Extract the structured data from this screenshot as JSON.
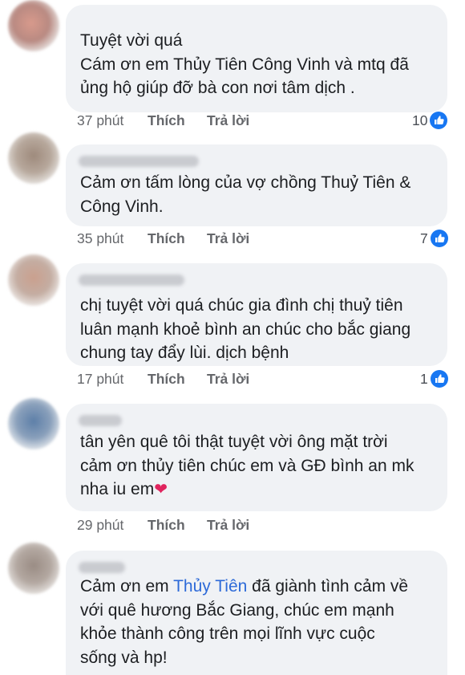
{
  "comments": [
    {
      "lines": [
        "Tuyệt vời quá",
        "Cám ơn em Thủy Tiên Công Vinh và mtq đã",
        "ủng hộ giúp đỡ bà con nơi tâm dịch ."
      ],
      "time": "37 phút",
      "like_label": "Thích",
      "reply_label": "Trả lời",
      "reactions": "10",
      "reaction_icon": "like-icon"
    },
    {
      "lines": [
        "Cảm ơn tấm lòng của vợ chồng Thuỷ Tiên &",
        "Công Vinh."
      ],
      "time": "35 phút",
      "like_label": "Thích",
      "reply_label": "Trả lời",
      "reactions": "7",
      "reaction_icon": "like-icon"
    },
    {
      "lines": [
        "chị tuyệt vời quá chúc gia đình chị thuỷ tiên",
        "luân mạnh khoẻ bình an chúc cho bắc giang",
        "chung tay đẩy lùi. dịch bệnh"
      ],
      "time": "17 phút",
      "like_label": "Thích",
      "reply_label": "Trả lời",
      "reactions": "1",
      "reaction_icon": "like-icon"
    },
    {
      "lines": [
        "tân yên quê tôi thật tuyệt vời ông mặt trời",
        "cảm ơn thủy tiên chúc em và GĐ bình an mk",
        "nha iu em"
      ],
      "line3_emoji": "❤",
      "time": "29 phút",
      "like_label": "Thích",
      "reply_label": "Trả lời"
    },
    {
      "line1_before": "Cảm ơn em ",
      "line1_mention": "Thủy Tiên",
      "line1_after": " đã giành tình cảm về",
      "lines": [
        "với quê hương Bắc Giang, chúc em mạnh",
        "khỏe thành công trên mọi lĩnh vực cuộc",
        "sống và hp!"
      ]
    }
  ],
  "colors": {
    "bubble": "#f0f2f5",
    "text": "#1c1e21",
    "meta": "#65676b",
    "mention": "#2d6ad8",
    "like_blue": "#1877f2",
    "heart": "#e0245e"
  }
}
